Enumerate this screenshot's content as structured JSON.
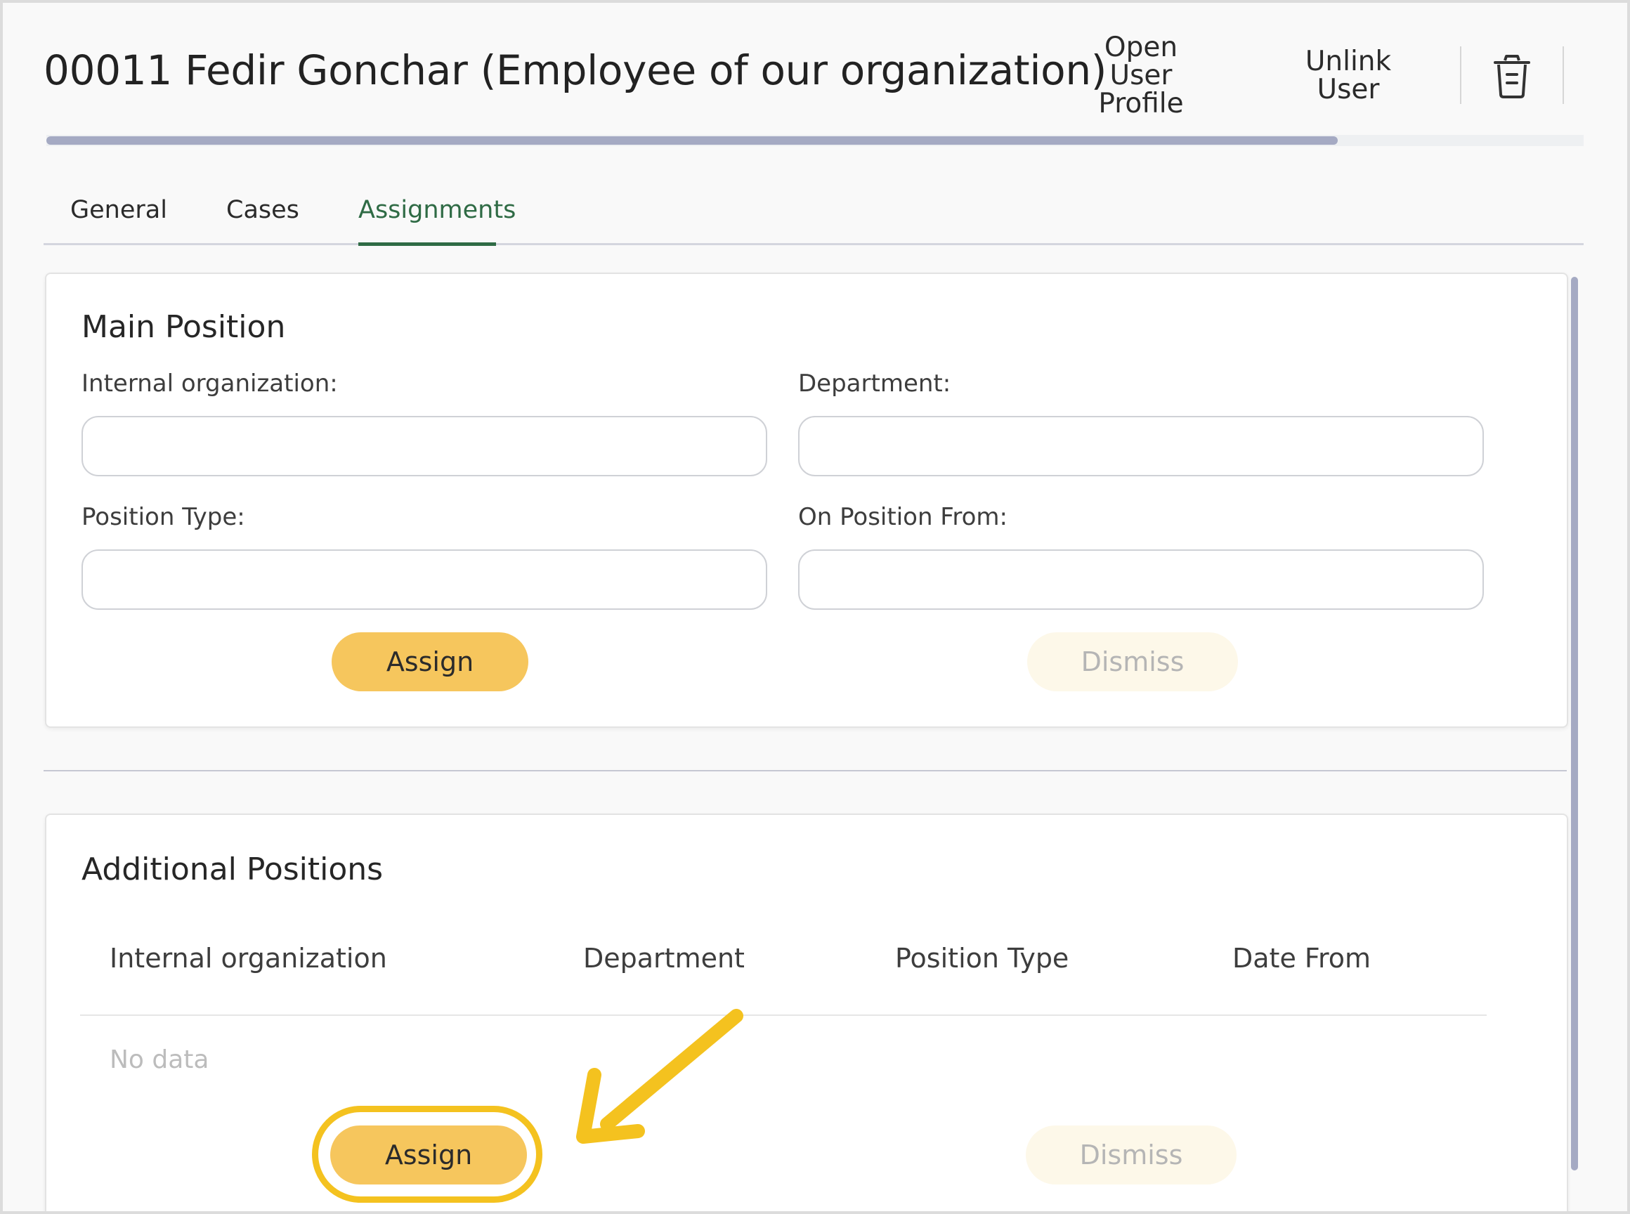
{
  "header": {
    "title": "00011 Fedir Gonchar (Employee of our organization)",
    "open_profile_lines": [
      "Open",
      "User",
      "Profile"
    ],
    "unlink_lines": [
      "Unlink",
      "User"
    ],
    "delete_icon": "trash-icon"
  },
  "progress": {
    "fraction": 0.84
  },
  "tabs": [
    {
      "label": "General",
      "active": false
    },
    {
      "label": "Cases",
      "active": false
    },
    {
      "label": "Assignments",
      "active": true
    }
  ],
  "main_position": {
    "title": "Main Position",
    "internal_org_label": "Internal organization:",
    "internal_org_value": "",
    "department_label": "Department:",
    "department_value": "",
    "position_type_label": "Position Type:",
    "position_type_value": "",
    "on_position_from_label": "On Position From:",
    "on_position_from_value": "",
    "assign_label": "Assign",
    "dismiss_label": "Dismiss"
  },
  "additional_positions": {
    "title": "Additional Positions",
    "columns": [
      "Internal organization",
      "Department",
      "Position Type",
      "Date From"
    ],
    "rows": [],
    "empty_text": "No data",
    "assign_label": "Assign",
    "dismiss_label": "Dismiss"
  },
  "colors": {
    "accent_green": "#2f6b45",
    "assign_yellow": "#f6c65d",
    "highlight_yellow": "#f4c21f",
    "progress": "#a5aac3"
  }
}
